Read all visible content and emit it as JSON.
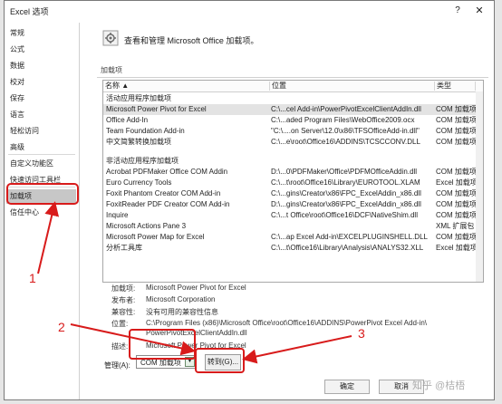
{
  "window": {
    "title": "Excel 选项",
    "help": "?",
    "close": "✕"
  },
  "sidebar": {
    "items": [
      {
        "label": "常规"
      },
      {
        "label": "公式"
      },
      {
        "label": "数据"
      },
      {
        "label": "校对"
      },
      {
        "label": "保存"
      },
      {
        "label": "语言"
      },
      {
        "label": "轻松访问"
      },
      {
        "label": "高级"
      },
      {
        "label": "自定义功能区"
      },
      {
        "label": "快速访问工具栏"
      },
      {
        "label": "加载项"
      },
      {
        "label": "信任中心"
      }
    ],
    "selected": "加载项"
  },
  "header": {
    "text": "查看和管理 Microsoft Office 加载项。",
    "icon": "addins-gear-icon"
  },
  "section": {
    "label": "加载项"
  },
  "grid": {
    "columns": [
      "名称 ▲",
      "位置",
      "类型"
    ],
    "active_category": "活动应用程序加载项",
    "active_rows": [
      {
        "name": "Microsoft Power Pivot for Excel",
        "location": "C:\\...cel Add-in\\PowerPivotExcelClientAddIn.dll",
        "type": "COM 加载项"
      },
      {
        "name": "Office Add-In",
        "location": "C:\\...aded Program Files\\WebOffice2009.ocx",
        "type": "COM 加载项"
      },
      {
        "name": "Team Foundation Add-in",
        "location": "\"C:\\....on Server\\12.0\\x86\\TFSOfficeAdd-in.dll\"",
        "type": "COM 加载项"
      },
      {
        "name": "中文简繁转换加载项",
        "location": "C:\\...e\\root\\Office16\\ADDINS\\TCSCCONV.DLL",
        "type": "COM 加载项"
      }
    ],
    "inactive_category": "非活动应用程序加载项",
    "inactive_rows": [
      {
        "name": "Acrobat PDFMaker Office COM Addin",
        "location": "D:\\...0\\PDFMaker\\Office\\PDFMOfficeAddin.dll",
        "type": "COM 加载项"
      },
      {
        "name": "Euro Currency Tools",
        "location": "C:\\...t\\root\\Office16\\Library\\EUROTOOL.XLAM",
        "type": "Excel 加载项"
      },
      {
        "name": "Foxit Phantom Creator COM Add-in",
        "location": "C:\\...gins\\Creator\\x86\\FPC_ExcelAddin_x86.dll",
        "type": "COM 加载项"
      },
      {
        "name": "FoxitReader PDF Creator COM Add-in",
        "location": "D:\\...gins\\Creator\\x86\\FPC_ExcelAddin_x86.dll",
        "type": "COM 加载项"
      },
      {
        "name": "Inquire",
        "location": "C:\\...t Office\\root\\Office16\\DCF\\NativeShim.dll",
        "type": "COM 加载项"
      },
      {
        "name": "Microsoft Actions Pane 3",
        "location": "",
        "type": "XML 扩展包"
      },
      {
        "name": "Microsoft Power Map for Excel",
        "location": "C:\\...ap Excel Add-in\\EXCELPLUGINSHELL.DLL",
        "type": "COM 加载项"
      },
      {
        "name": "分析工具库",
        "location": "C:\\...t\\Office16\\Library\\Analysis\\ANALYS32.XLL",
        "type": "Excel 加载项"
      }
    ]
  },
  "details": {
    "addin_label": "加载项:",
    "addin_value": "Microsoft Power Pivot for Excel",
    "publisher_label": "发布者:",
    "publisher_value": "Microsoft Corporation",
    "compat_label": "兼容性:",
    "compat_value": "没有可用的兼容性信息",
    "location_label": "位置:",
    "location_value_1": "C:\\Program Files (x86)\\Microsoft Office\\root\\Office16\\ADDINS\\PowerPivot Excel Add-in\\",
    "location_value_2": "PowerPivotExcelClientAddIn.dll",
    "desc_label": "描述:",
    "desc_value": "Microsoft Power Pivot for Excel"
  },
  "manage": {
    "label": "管理(A):",
    "selected": "COM 加载项",
    "go_button": "转到(G)..."
  },
  "buttons": {
    "ok": "确定",
    "cancel": "取消"
  },
  "watermark": "知乎 @桔梧",
  "annotations": {
    "n1": "1",
    "n2": "2",
    "n3": "3"
  },
  "colors": {
    "annotation": "#d81b1b",
    "selection": "#c7c7c7"
  }
}
